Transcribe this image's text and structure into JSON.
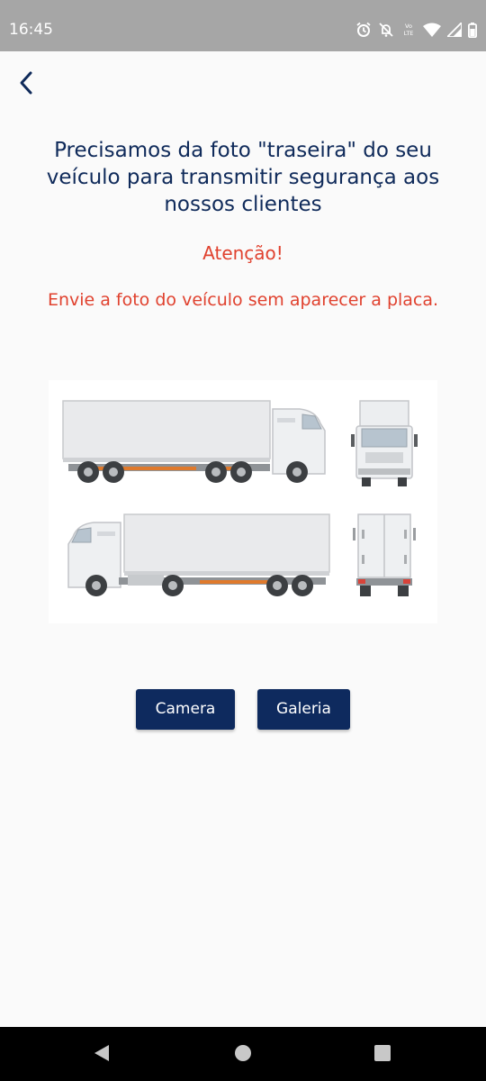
{
  "status_bar": {
    "time": "16:45",
    "icons": [
      "alarm-icon",
      "notifications-off-icon",
      "volte-icon",
      "wifi-icon",
      "signal-icon",
      "battery-icon"
    ]
  },
  "header": {
    "back_icon": "chevron-left-icon"
  },
  "content": {
    "headline": "Precisamos da foto \"traseira\" do seu veículo para transmitir segurança aos nossos clientes",
    "attention": "Atenção!",
    "warning": "Envie a foto do veículo sem aparecer a placa."
  },
  "actions": {
    "camera_label": "Camera",
    "gallery_label": "Galeria"
  },
  "colors": {
    "primary": "#0e2a5e",
    "headline": "#0f2a5a",
    "alert": "#e0412e",
    "status_bar": "#a6a6a6",
    "background": "#fafafa"
  },
  "nav_bar": {
    "icons": [
      "back-triangle-icon",
      "home-circle-icon",
      "recents-square-icon"
    ]
  }
}
